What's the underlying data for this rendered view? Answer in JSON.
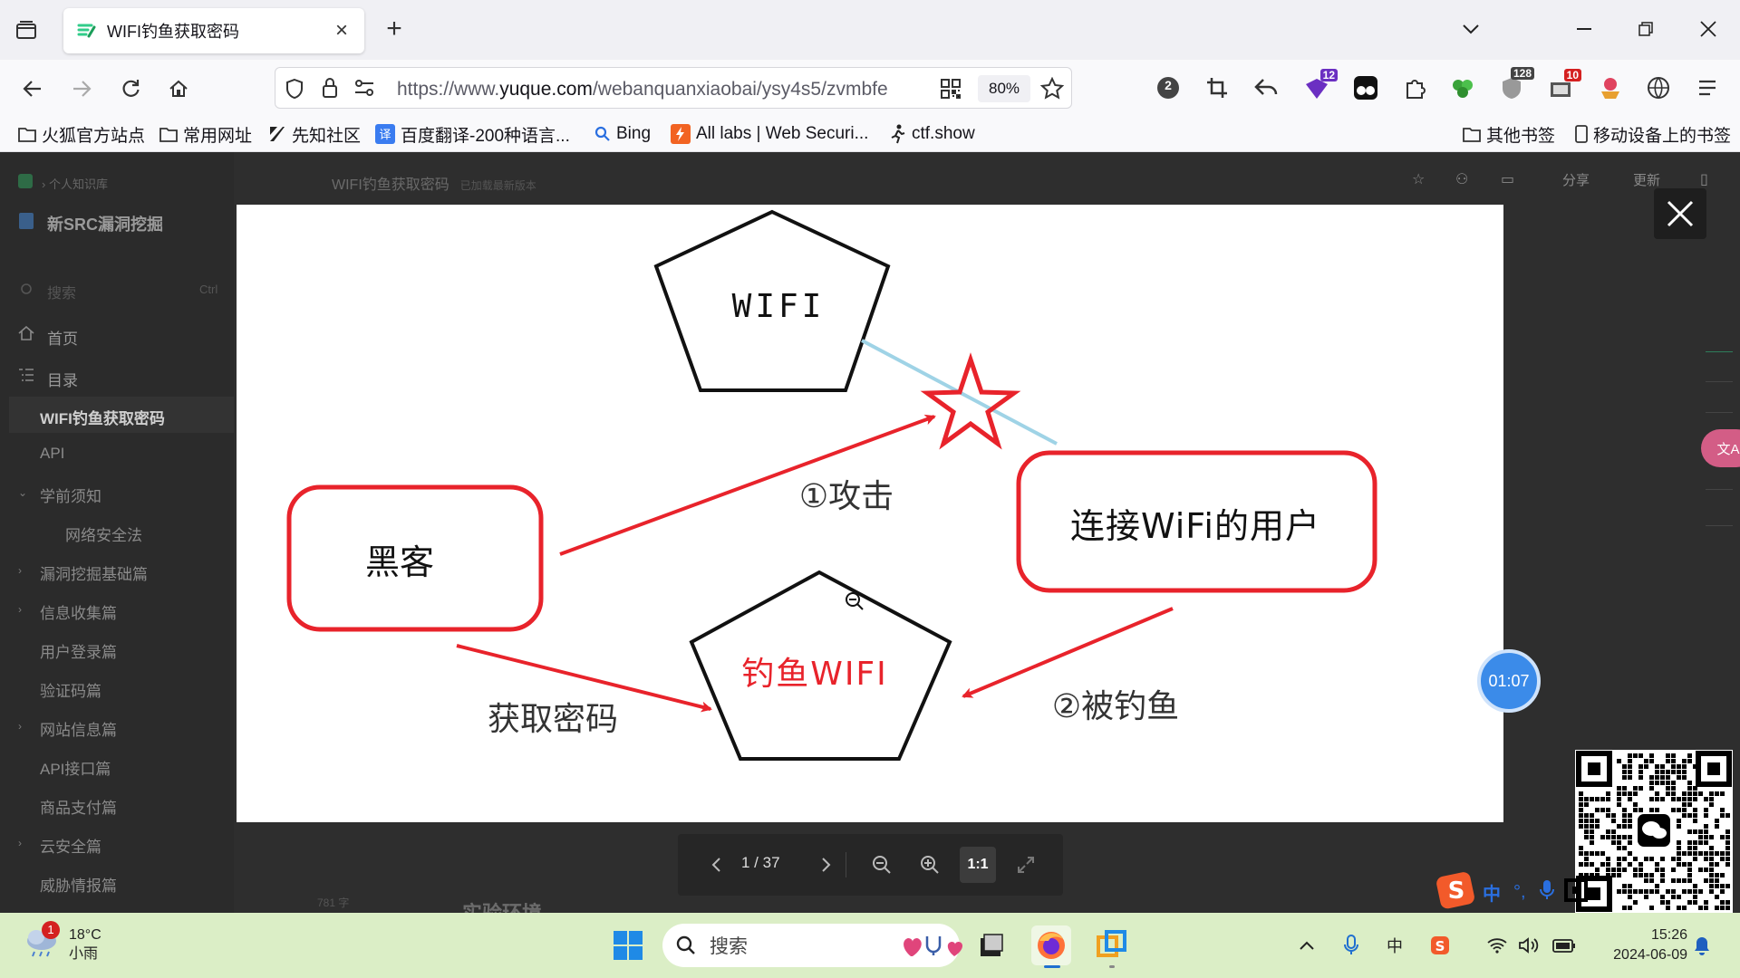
{
  "browser": {
    "tab_title": "WIFI钓鱼获取密码",
    "url_host_prefix": "https://www.",
    "url_host": "yuque.com",
    "url_path": "/webanquanxiaobai/ysy4s5/zvmbfe",
    "zoom": "80%",
    "extension_badges": {
      "github": "2",
      "ext_purple": "12",
      "ext_counter": "128",
      "ext_mail": "10"
    }
  },
  "bookmarks": [
    "火狐官方站点",
    "常用网址",
    "先知社区",
    "百度翻译-200种语言...",
    "Bing",
    "All labs | Web Securi...",
    "ctf.show"
  ],
  "bookmarks_right": [
    "其他书签",
    "移动设备上的书签"
  ],
  "page": {
    "breadcrumb": "个人知识库",
    "book_title": "新SRC漏洞挖掘",
    "search_placeholder": "搜索",
    "search_shortcut": "Ctrl",
    "doc_title": "WIFI钓鱼获取密码",
    "doc_status": "已加载最新版本",
    "share_label": "分享",
    "update_label": "更新",
    "sidebar": {
      "home": "首页",
      "toc": "目录",
      "items": [
        {
          "label": "WIFI钓鱼获取密码",
          "level": "main",
          "active": true
        },
        {
          "label": "API",
          "level": "main"
        },
        {
          "label": "学前须知",
          "level": "main",
          "expanded": true
        },
        {
          "label": "网络安全法",
          "level": "sub"
        },
        {
          "label": "漏洞挖掘基础篇",
          "level": "main",
          "collapsible": true
        },
        {
          "label": "信息收集篇",
          "level": "main",
          "collapsible": true
        },
        {
          "label": "用户登录篇",
          "level": "main"
        },
        {
          "label": "验证码篇",
          "level": "main"
        },
        {
          "label": "网站信息篇",
          "level": "main",
          "collapsible": true
        },
        {
          "label": "API接口篇",
          "level": "main"
        },
        {
          "label": "商品支付篇",
          "level": "main"
        },
        {
          "label": "云安全篇",
          "level": "main",
          "collapsible": true
        },
        {
          "label": "威胁情报篇",
          "level": "main"
        }
      ]
    },
    "word_count": "781 字",
    "next_section": "实验环境"
  },
  "diagram": {
    "wifi_label": "WIFI",
    "hacker_label": "黑客",
    "user_label": "连接WiFi的用户",
    "phish_wifi_label": "钓鱼WIFI",
    "attack_label": "①攻击",
    "phished_label": "②被钓鱼",
    "get_password_label": "获取密码"
  },
  "viewer": {
    "page_indicator": "1 / 37",
    "actual_size_label": "1:1"
  },
  "floating": {
    "timer": "01:07",
    "translate_label": "文A"
  },
  "ime": {
    "mode": "中"
  },
  "taskbar": {
    "weather_temp": "18°C",
    "weather_desc": "小雨",
    "weather_badge": "1",
    "search_placeholder": "搜索",
    "time": "15:26",
    "date": "2024-06-09",
    "ime_lang": "中"
  },
  "colors": {
    "diagram_red": "#e8232b",
    "wifi_link": "#9fd3e6",
    "timer_blue": "#3b8be9"
  }
}
